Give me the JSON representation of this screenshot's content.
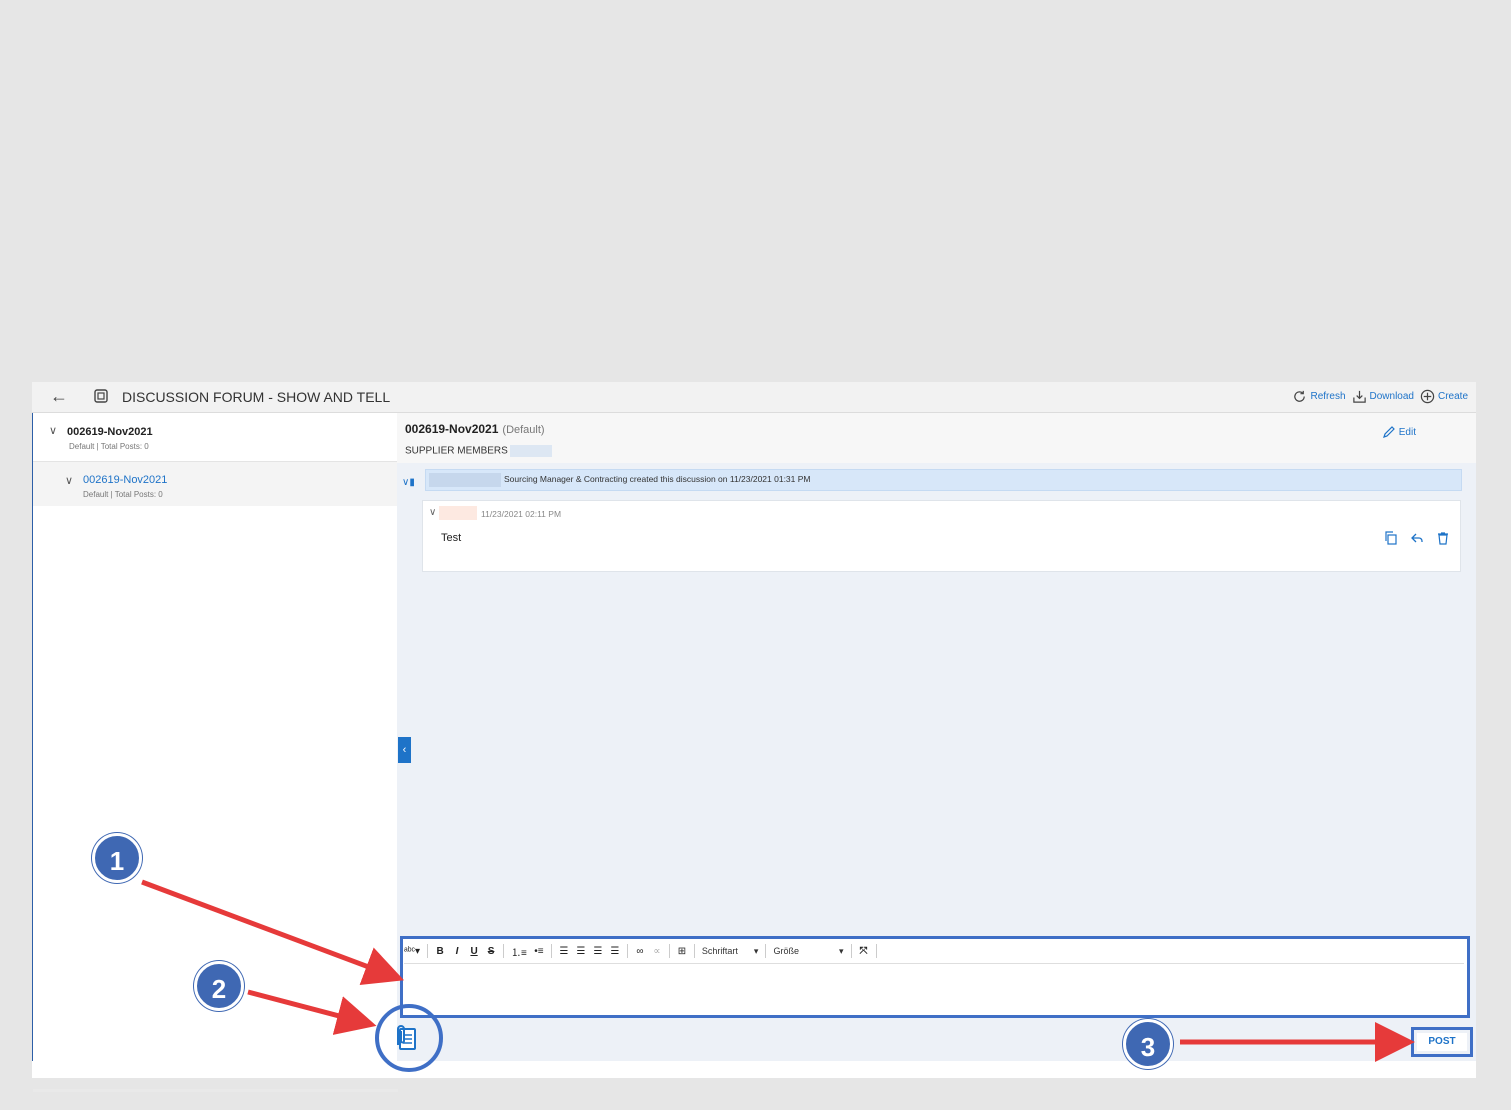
{
  "header": {
    "title": "DISCUSSION FORUM - SHOW AND TELL",
    "refresh": "Refresh",
    "download": "Download",
    "create": "Create"
  },
  "tree": [
    {
      "name": "002619-Nov2021",
      "meta": "Default | Total Posts: 0"
    },
    {
      "name": "002619-Nov2021",
      "meta": "Default | Total Posts: 0"
    }
  ],
  "discussion": {
    "title": "002619-Nov2021",
    "default_tag": "(Default)",
    "members_label": "SUPPLIER MEMBERS",
    "edit": "Edit",
    "banner": "Sourcing Manager & Contracting created this discussion on 11/23/2021 01:31 PM"
  },
  "post": {
    "date": "11/23/2021 02:11 PM",
    "text": "Test"
  },
  "editor": {
    "bold": "B",
    "italic": "I",
    "underline": "U",
    "strike": "S",
    "font_label": "Schriftart",
    "size_label": "Größe",
    "dropdown_caret": "▾"
  },
  "post_button": "POST",
  "callouts": [
    "1",
    "2",
    "3"
  ],
  "colors": {
    "accent": "#1e73c8",
    "frame": "#3f6fc6",
    "arrow": "#e63a3a",
    "callout": "#3f68b3"
  }
}
